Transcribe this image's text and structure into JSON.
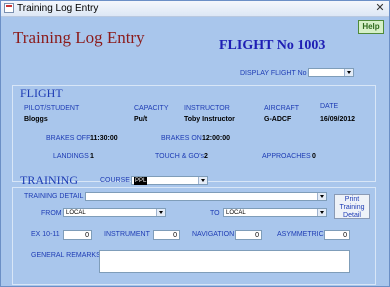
{
  "window": {
    "title": "Training Log Entry",
    "close_glyph": "✕"
  },
  "header": {
    "title": "Training Log Entry",
    "flight_title": "FLIGHT No 1003",
    "help_label": "Help"
  },
  "display_flight": {
    "label": "DISPLAY FLIGHT No",
    "value": ""
  },
  "flight": {
    "section_title": "FLIGHT",
    "pilot_label": "PILOT/STUDENT",
    "pilot_value": "Bloggs",
    "capacity_label": "CAPACITY",
    "capacity_value": "Pu/t",
    "instructor_label": "INSTRUCTOR",
    "instructor_value": "Toby Instructor",
    "aircraft_label": "AIRCRAFT",
    "aircraft_value": "G-ADCF",
    "date_label": "DATE",
    "date_value": "16/09/2012",
    "brakes_off_label": "BRAKES OFF",
    "brakes_off_value": "11:30:00",
    "brakes_on_label": "BRAKES ON",
    "brakes_on_value": "12:00:00",
    "landings_label": "LANDINGS",
    "landings_value": "1",
    "touch_go_label": "TOUCH & GO's",
    "touch_go_value": "2",
    "approaches_label": "APPROACHES",
    "approaches_value": "0"
  },
  "training": {
    "section_title": "TRAINING",
    "course_label": "COURSE",
    "course_value": "PPL",
    "detail_label": "TRAINING DETAIL",
    "detail_value": "",
    "from_label": "FROM",
    "from_value": "LOCAL",
    "to_label": "TO",
    "to_value": "LOCAL",
    "print_button": "Print Training Detail",
    "ex1011_label": "EX 10-11",
    "ex1011_value": "0",
    "instrument_label": "INSTRUMENT",
    "instrument_value": "0",
    "navigation_label": "NAVIGATION",
    "navigation_value": "0",
    "asymmetric_label": "ASYMMETRIC",
    "asymmetric_value": "0",
    "remarks_label": "GENERAL REMARKS",
    "remarks_value": ""
  },
  "colors": {
    "background": "#a9c6ec",
    "label": "#1e3cb4",
    "title_red": "#8b1a1a",
    "flight_blue": "#1e1eb4"
  }
}
